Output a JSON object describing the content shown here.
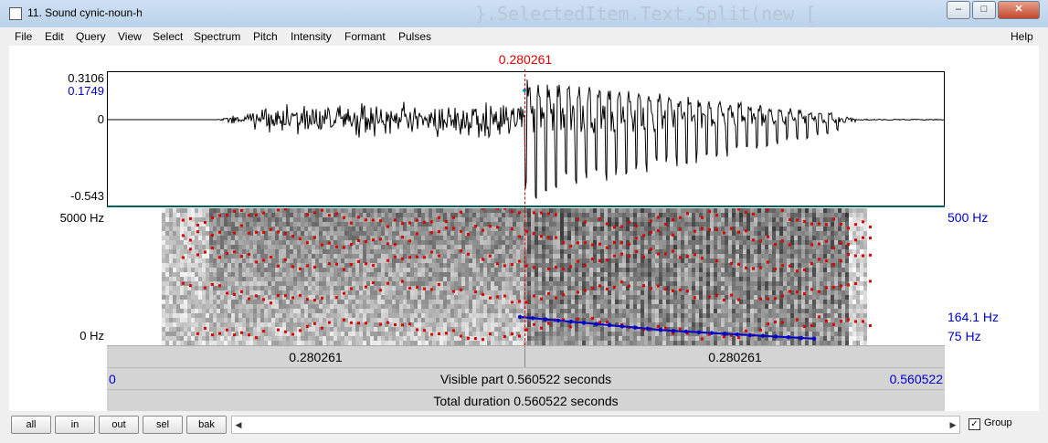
{
  "window": {
    "title": "11. Sound cynic-noun-h",
    "background_code": "}.SelectedItem.Text.Split(new ["
  },
  "menu": {
    "items": [
      "File",
      "Edit",
      "Query",
      "View",
      "Select",
      "Spectrum",
      "Pitch",
      "Intensity",
      "Formant",
      "Pulses"
    ],
    "help": "Help"
  },
  "cursor": {
    "time": "0.280261",
    "fraction": 0.5
  },
  "waveform": {
    "max_label": "0.3106",
    "cursor_value": "0.1749",
    "zero_label": "0",
    "min_label": "-0.543"
  },
  "spectrogram": {
    "top_freq": "5000 Hz",
    "bottom_freq": "0 Hz",
    "pitch_top": "500 Hz",
    "pitch_value": "164.1 Hz",
    "pitch_bottom": "75 Hz"
  },
  "time_axis": {
    "left_segment": "0.280261",
    "right_segment": "0.280261",
    "visible_start": "0",
    "visible_end": "0.560522",
    "visible_label": "Visible part 0.560522 seconds",
    "total_label": "Total duration 0.560522 seconds"
  },
  "bottom": {
    "buttons": [
      "all",
      "in",
      "out",
      "sel",
      "bak"
    ],
    "group_label": "Group",
    "group_checked": true
  },
  "colors": {
    "cursor": "#dd0000",
    "formant": "#dd0000",
    "pitch": "#0000cc",
    "wave_border": "#006060"
  }
}
